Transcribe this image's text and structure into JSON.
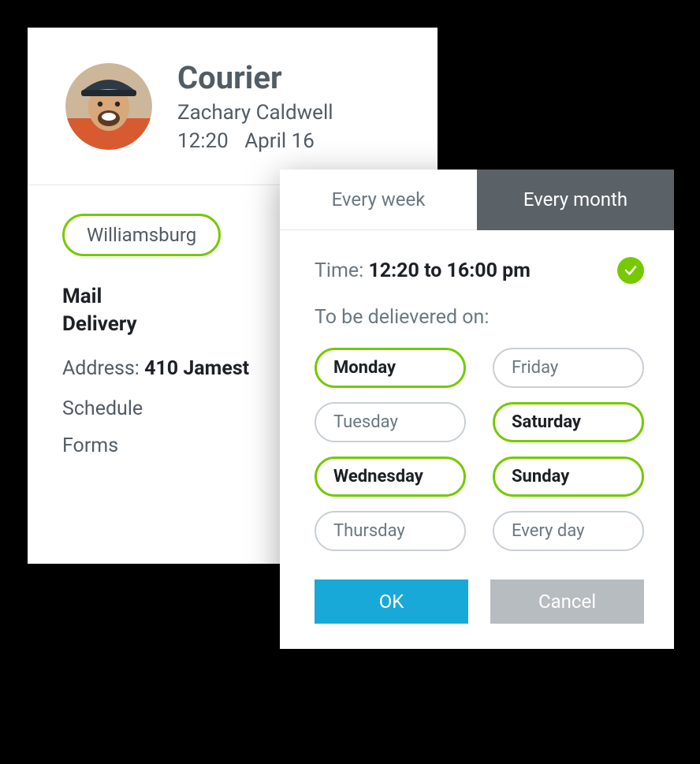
{
  "courier": {
    "title": "Courier",
    "name": "Zachary Caldwell",
    "time": "12:20",
    "date": "April 16",
    "route": "Williamsburg",
    "task_line1": "Mail",
    "task_line2": "Delivery",
    "address_label": "Address:",
    "address_value": "410 Jamest",
    "schedule_label": "Schedule",
    "forms_label": "Forms"
  },
  "schedule": {
    "tabs": {
      "week": "Every week",
      "month": "Every month"
    },
    "active_tab": "month",
    "time_label": "Time:",
    "time_from": "12:20",
    "time_to_word": "to",
    "time_to": "16:00",
    "time_suffix": "pm",
    "deliver_label": "To  be delievered on:",
    "days": [
      {
        "label": "Monday",
        "selected": true
      },
      {
        "label": "Friday",
        "selected": false
      },
      {
        "label": "Tuesday",
        "selected": false
      },
      {
        "label": "Saturday",
        "selected": true
      },
      {
        "label": "Wednesday",
        "selected": true
      },
      {
        "label": "Sunday",
        "selected": true
      },
      {
        "label": "Thursday",
        "selected": false
      },
      {
        "label": "Every day",
        "selected": false
      }
    ],
    "ok_label": "OK",
    "cancel_label": "Cancel"
  },
  "colors": {
    "accent_green": "#76c900",
    "accent_blue": "#19a9d8"
  }
}
